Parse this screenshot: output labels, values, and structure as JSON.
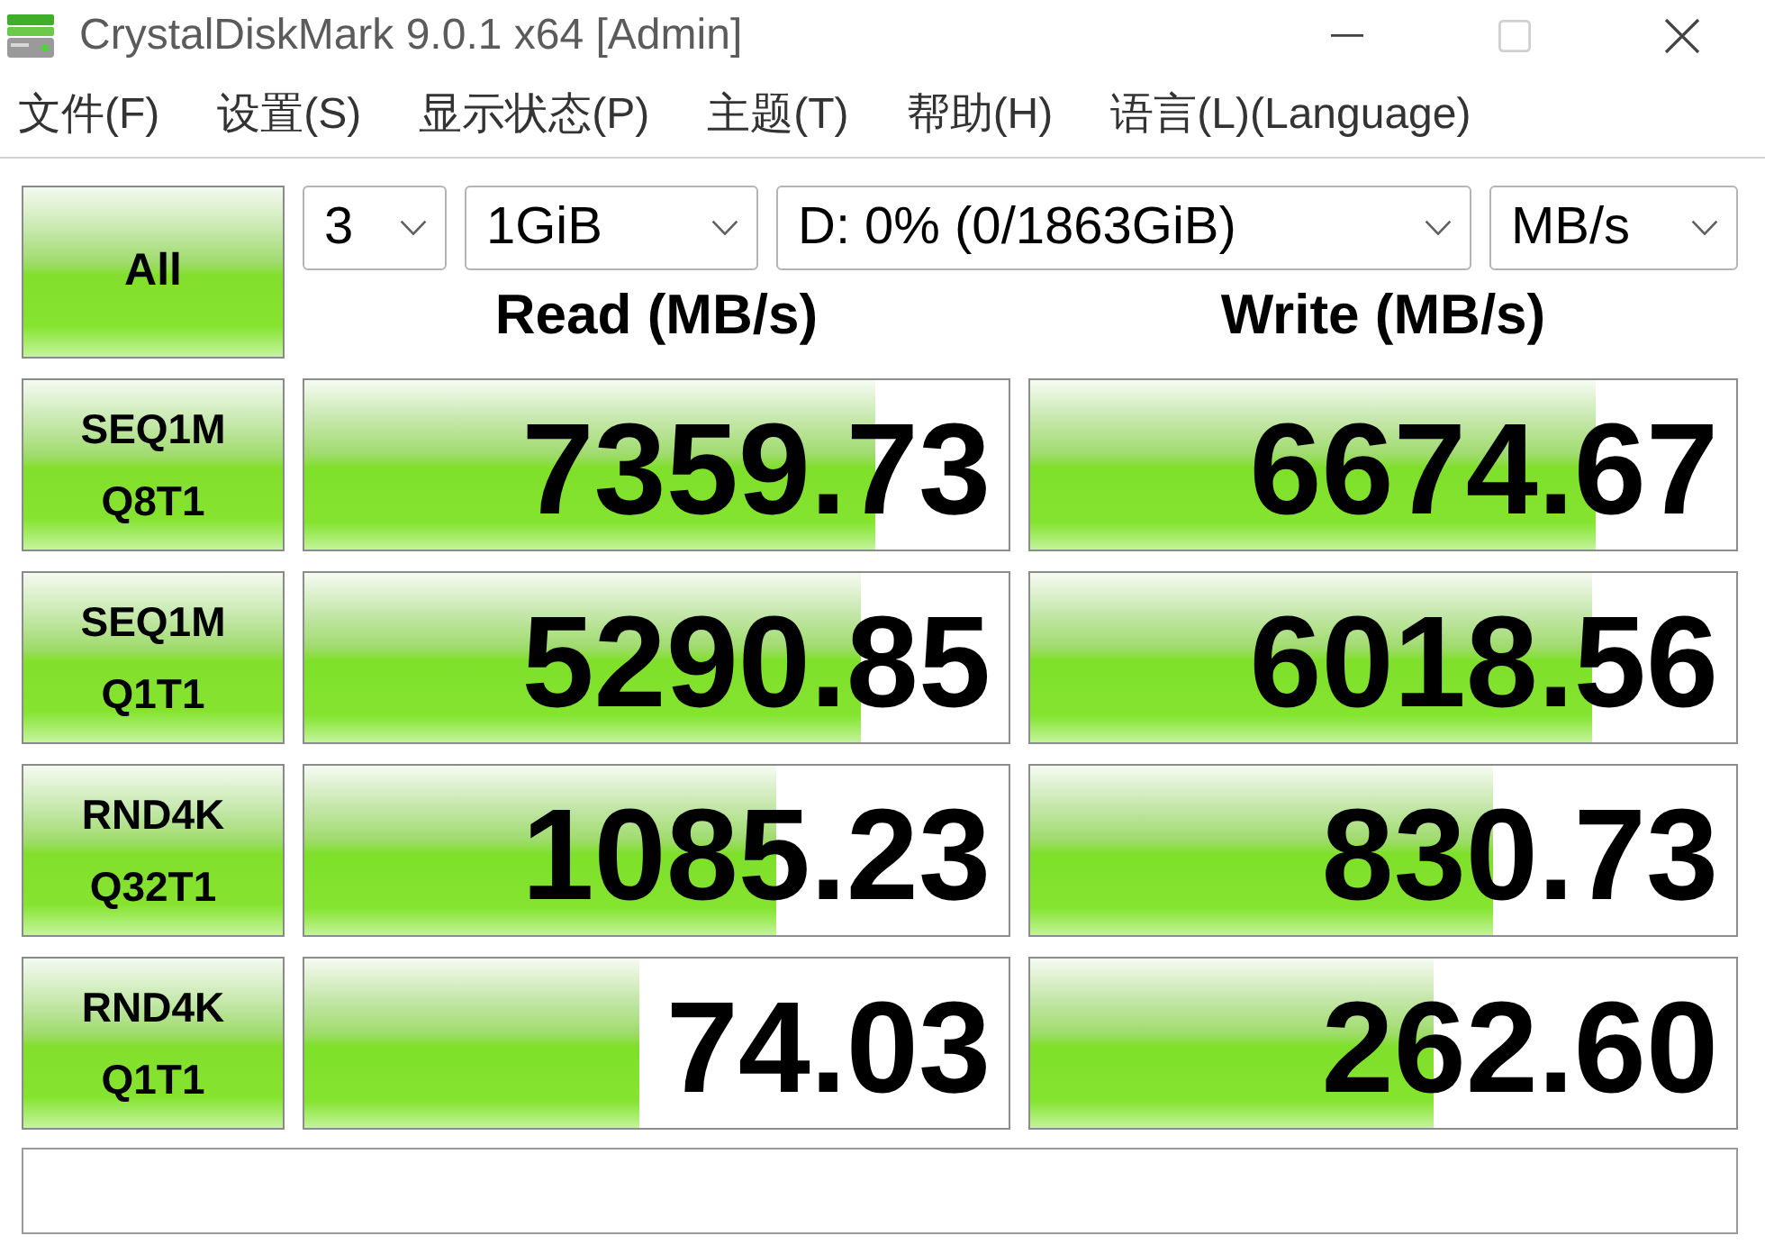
{
  "window": {
    "title": "CrystalDiskMark 9.0.1 x64 [Admin]",
    "controls": [
      {
        "kind": "minimize",
        "disabled": false
      },
      {
        "kind": "maximize",
        "disabled": true
      },
      {
        "kind": "close",
        "disabled": false
      }
    ]
  },
  "menu": [
    "文件(F)",
    "设置(S)",
    "显示状态(P)",
    "主题(T)",
    "帮助(H)",
    "语言(L)(Language)"
  ],
  "all_button": "All",
  "settings": [
    {
      "kind": "count",
      "value": "3"
    },
    {
      "kind": "size",
      "value": "1GiB"
    },
    {
      "kind": "drive",
      "value": "D: 0% (0/1863GiB)"
    },
    {
      "kind": "unit",
      "value": "MB/s"
    }
  ],
  "columns": [
    "Read (MB/s)",
    "Write (MB/s)"
  ],
  "tests": [
    {
      "label": [
        "SEQ1M",
        "Q8T1"
      ],
      "read": {
        "value": "7359.73",
        "level": 0.81
      },
      "write": {
        "value": "6674.67",
        "level": 0.8
      }
    },
    {
      "label": [
        "SEQ1M",
        "Q1T1"
      ],
      "read": {
        "value": "5290.85",
        "level": 0.79
      },
      "write": {
        "value": "6018.56",
        "level": 0.795
      }
    },
    {
      "label": [
        "RND4K",
        "Q32T1"
      ],
      "read": {
        "value": "1085.23",
        "level": 0.67
      },
      "write": {
        "value": "830.73",
        "level": 0.655
      }
    },
    {
      "label": [
        "RND4K",
        "Q1T1"
      ],
      "read": {
        "value": "74.03",
        "level": 0.476
      },
      "write": {
        "value": "262.60",
        "level": 0.571
      }
    }
  ]
}
